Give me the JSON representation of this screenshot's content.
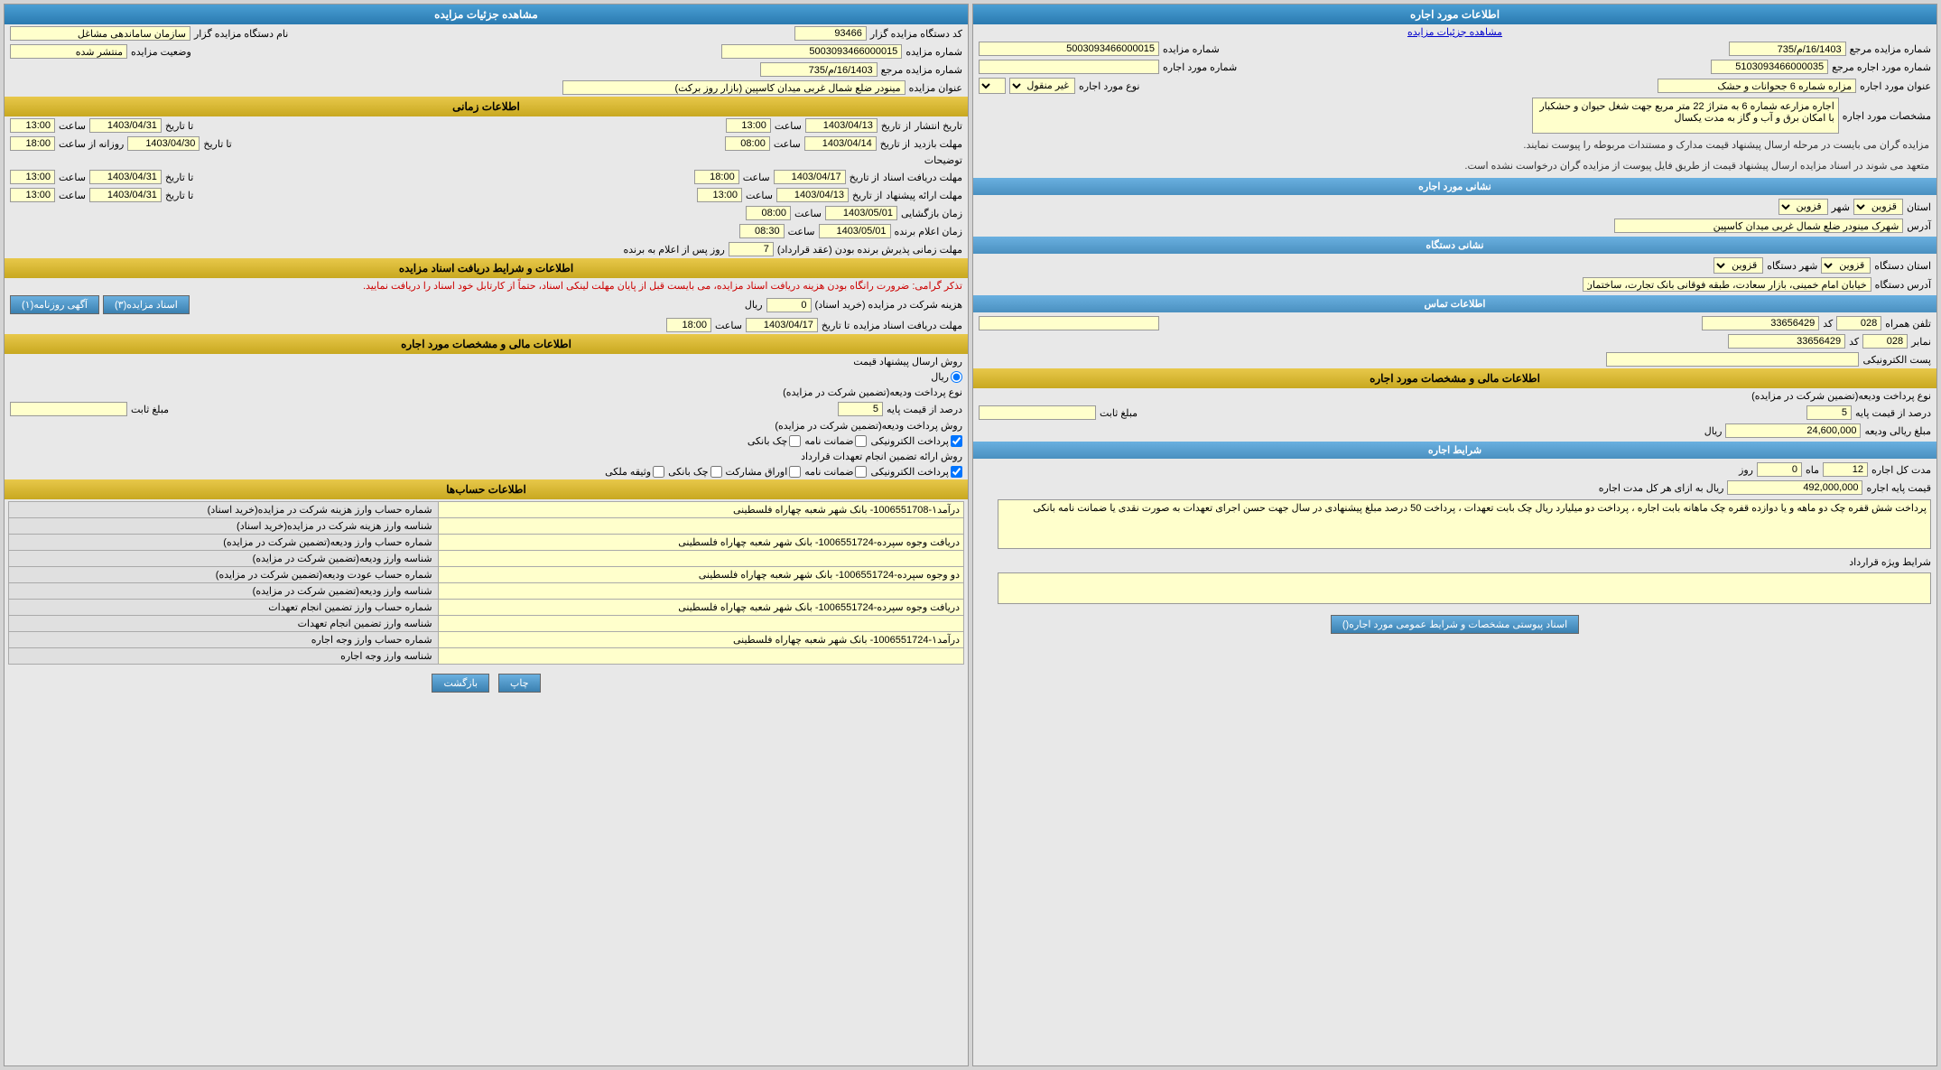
{
  "left_panel": {
    "title": "اطلاعات مورد اجاره",
    "link": "مشاهده جزئیات مزایده",
    "rows": [
      {
        "label1": "شماره مزایده مرجع",
        "value1": "16/1403/م/735",
        "label2": "شماره مزایده",
        "value2": "5003093466000015"
      },
      {
        "label1": "شماره مورد اجاره مرجع",
        "value1": "5103093466000035",
        "label2": "شماره مورد اجاره",
        "value2": ""
      },
      {
        "label1": "عنوان مورد اجاره",
        "value1": "مزاره شماره 6 جحوانات و حشک",
        "label2": "نوع مورد اجاره",
        "value2": "غیر منقول"
      }
    ],
    "description_label": "مشخصات مورد اجاره",
    "description": "اجاره مزارعه شماره 6 به متراژ 22 متر مربع جهت شغل حیوان و حشکبار با امکان برق و آب و گاز به مدت یکسال",
    "info_text1": "مزایده گران می بایست در مرحله ارسال پیشنهاد قیمت مدارک و مستندات مربوطه را پیوست نمایند.",
    "info_text2": "متعهد می شوند در اسناد مزایده ارسال پیشنهاد قیمت از طریق فایل پیوست از مزایده گران درخواست نشده است.",
    "address_section": {
      "title": "نشانی مورد اجاره",
      "state_label": "استان",
      "state_value": "قزوین",
      "city_label": "شهر",
      "city_value": "قزوین",
      "address_label": "آدرس",
      "address_value": "شهرک مینودر ضلع شمال غربی میدان کاسپین"
    },
    "device_section": {
      "title": "نشانی دستگاه",
      "state_label": "استان دستگاه",
      "state_value": "قزوین",
      "city_label": "شهر دستگاه",
      "city_value": "قزوین",
      "address_label": "آدرس دستگاه",
      "address_value": "خیابان امام خمینی، بازار سعادت، طبقه فوقانی بانک تجارت، ساختمان سازمان سامانده مشاع"
    },
    "contact_section": {
      "title": "اطلاعات تماس",
      "phone_label": "تلفن همراه",
      "phone_value": "33656429",
      "phone_code": "028",
      "fax_label": "نمابر",
      "fax_value": "33656429",
      "fax_code": "028",
      "email_label": "پست الکترونیکی",
      "email_value": ""
    },
    "financial_section": {
      "title": "اطلاعات مالی و مشخصات مورد اجاره",
      "payment_type_label": "نوع پرداخت ودیعه(تضمین شرکت در مزایده)",
      "percent_label": "درصد از قیمت پایه",
      "percent_value": "5",
      "fixed_label": "مبلغ ثابت",
      "amount_label": "مبلغ ریالی ودیعه",
      "amount_value": "24,600,000",
      "currency": "ریال"
    },
    "lease_conditions": {
      "title": "شرایط اجاره",
      "duration_label": "مدت کل اجاره",
      "months": "12",
      "days": "0",
      "month_label": "ماه",
      "day_label": "روز",
      "base_rent_label": "قیمت پایه اجاره",
      "base_rent_value": "492,000,000",
      "currency": "ریال به ازای هر کل مدت اجاره",
      "conditions_text": "پرداخت شش قفره چک دو ماهه و یا دوازده قفره چک ماهانه بابت اجاره ، پرداخت دو میلیارد ریال چک بابت تعهدات ، پرداخت 50 درصد مبلغ پیشنهادی در سال جهت حسن اجرای تعهدات به صورت نقدی یا ضمانت نامه بانکی",
      "special_conditions_label": "شرایط ویژه قرارداد",
      "special_conditions_value": "",
      "button_label": "اسناد پیوستی مشخصات و شرایط عمومی مورد اجاره()"
    }
  },
  "right_panel": {
    "title": "مشاهده جزئیات مزایده",
    "fields": {
      "tender_code_label": "کد دستگاه مزایده گزار",
      "tender_code_value": "93466",
      "system_name_label": "نام دستگاه مزایده گزار",
      "system_name_value": "سازمان ساماندهی مشاغل",
      "tender_num_label": "شماره مزایده",
      "tender_num_value": "5003093466000015",
      "status_label": "وضعیت مزایده",
      "status_value": "منتشر شده",
      "ref_num_label": "شماره مزایده مرجع",
      "ref_num_value": "16/1403/م/735",
      "title_label": "عنوان مزایده",
      "title_value": "مینودر ضلع شمال غربی میدان کاسپین (بازار روز برکت)"
    },
    "time_section": {
      "title": "اطلاعات زمانی",
      "pub_from_label": "از تاریخ",
      "pub_from_date": "1403/04/13",
      "pub_from_time_label": "ساعت",
      "pub_from_time": "13:00",
      "pub_to_label": "تا تاریخ",
      "pub_to_date": "1403/04/31",
      "pub_to_time_label": "ساعت",
      "pub_to_time": "13:00",
      "pub_label": "تاریخ انتشار",
      "deadline_label": "مهلت بازدید",
      "deadline_from_date": "1403/04/14",
      "deadline_from_time": "08:00",
      "deadline_to_date": "1403/04/30",
      "deadline_to_time": "18:00",
      "notes_label": "توضیحات",
      "doc_deadline_label": "مهلت دریافت اسناد",
      "doc_deadline_from_date": "1403/04/17",
      "doc_deadline_from_time": "18:00",
      "doc_deadline_to_date": "1403/04/31",
      "doc_deadline_to_time": "13:00",
      "submit_label": "مهلت ارائه پیشنهاد",
      "submit_from_date": "1403/04/13",
      "submit_from_time": "13:00",
      "submit_to_date": "1403/04/31",
      "submit_to_time": "13:00",
      "review_label": "زمان بازگشایی",
      "review_date": "1403/05/01",
      "review_time": "08:00",
      "winner_label": "زمان اعلام برنده",
      "winner_date": "1403/05/01",
      "winner_time": "08:30",
      "contract_days_label": "مهلت زمانی پذیرش برنده بودن (عقد قرارداد)",
      "contract_days": "7",
      "contract_days_suffix": "روز پس از اعلام به برنده"
    },
    "doc_section": {
      "title": "اطلاعات و شرایط دریافت اسناد مزایده",
      "notice": "تذکر گرامی: ضرورت رانگاه بودن هزینه دریافت اسناد مزایده، می بایست قبل از پایان مهلت لینکی اسناد، حتماً از کارتابل خود اسناد را دریافت نمایید.",
      "fee_label": "هزینه شرکت در مزایده (خرید اسناد)",
      "fee_value": "0",
      "currency": "ریال",
      "doc_btn_label": "اسناد مزایده(۳)",
      "ad_btn_label": "آگهی روزنامه(۱)",
      "deadline_label": "مهلت دریافت اسناد مزایده",
      "deadline_to_date": "1403/04/17",
      "deadline_to_time": "18:00"
    },
    "financial2_section": {
      "title": "اطلاعات مالی و مشخصات مورد اجاره",
      "send_method_label": "روش ارسال پیشنهاد قیمت",
      "currency_option": "ریال",
      "payment_type_label": "نوع پرداخت ودیعه(تضمین شرکت در مزایده)",
      "percent_label": "درصد از قیمت پایه",
      "percent_value": "5",
      "fixed_label": "مبلغ ثابت",
      "payment_methods_label": "روش پرداخت ودیعه(تضمین شرکت در مزایده)",
      "payment_method_options": [
        "پرداخت الکترونیکی",
        "ضمانت نامه",
        "چک بانکی"
      ],
      "contract_methods_label": "روش ارائه تضمین انجام تعهدات قرارداد",
      "contract_method_options": [
        "پرداخت الکترونیکی",
        "ضمانت نامه",
        "اوراق مشارکت",
        "چک بانکی",
        "وثیقه ملکی"
      ]
    },
    "accounts_section": {
      "title": "اطلاعات حساب‌ها",
      "rows": [
        {
          "label": "شماره حساب وارز هزینه شرکت در مزایده(خرید اسناد)",
          "value": "درآمد۱-1006551708- بانک شهر شعبه چهاراه فلسطینی"
        },
        {
          "label": "شناسه وارز هزینه شرکت در مزایده(خرید اسناد)",
          "value": ""
        },
        {
          "label": "شماره حساب وارز ودیعه(تضمین شرکت در مزایده)",
          "value": "دریافت وجوه سپرده-1006551724- بانک شهر شعبه چهاراه فلسطینی"
        },
        {
          "label": "شناسه وارز ودیعه(تضمین شرکت در مزایده)",
          "value": ""
        },
        {
          "label": "شماره حساب عودت ودیعه(تضمین شرکت در مزایده)",
          "value": "دو وجوه سپرده-1006551724- بانک شهر شعبه چهاراه فلسطینی"
        },
        {
          "label": "شناسه وارز ودیعه(تضمین شرکت در مزایده)",
          "value": ""
        },
        {
          "label": "شماره حساب وارز تضمین انجام تعهدات",
          "value": "دریافت وجوه سپرده-1006551724- بانک شهر شعبه چهاراه فلسطینی"
        },
        {
          "label": "شناسه وارز تضمین انجام تعهدات",
          "value": ""
        },
        {
          "label": "شماره حساب وارز وجه اجاره",
          "value": "درآمد۱-1006551724- بانک شهر شعبه چهاراه فلسطینی"
        },
        {
          "label": "شناسه وارز وجه اجاره",
          "value": ""
        }
      ]
    },
    "bottom_buttons": {
      "print_label": "چاپ",
      "back_label": "بازگشت"
    }
  }
}
